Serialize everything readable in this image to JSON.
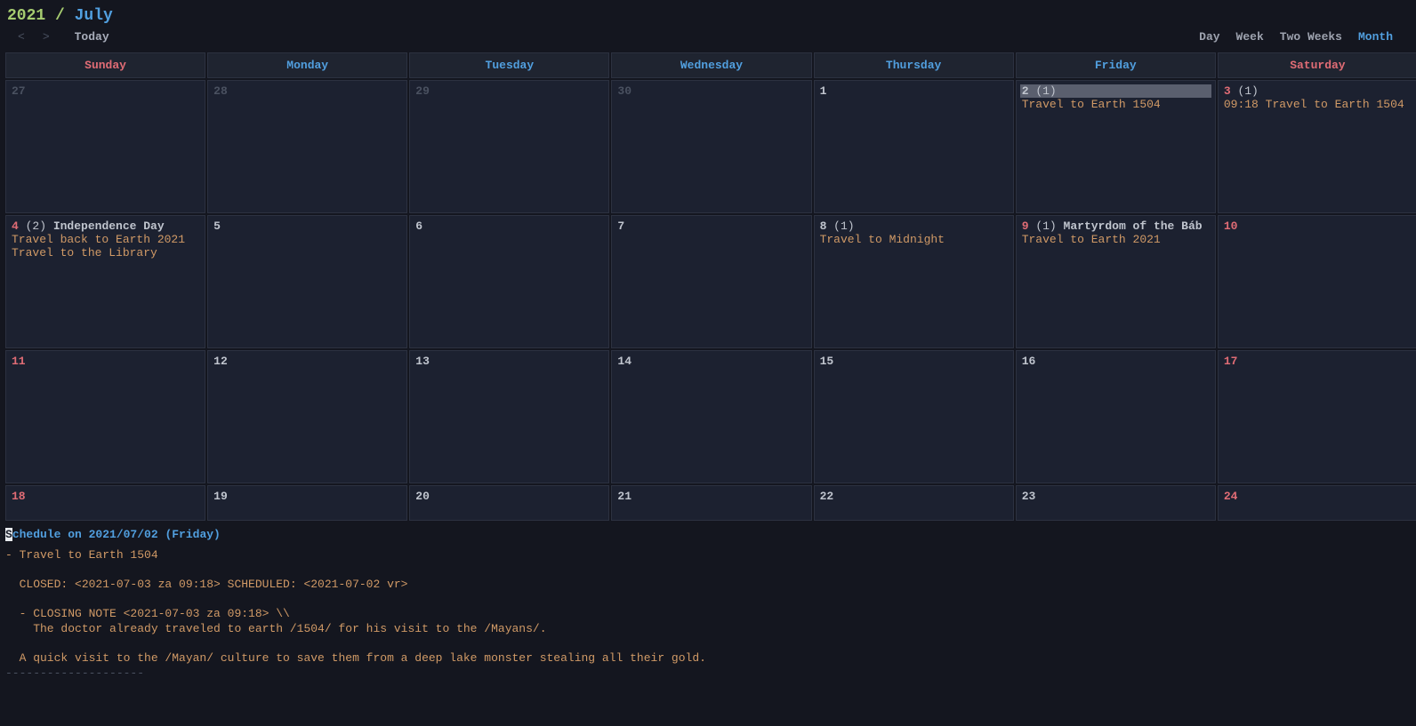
{
  "title": {
    "year": "2021",
    "sep": " / ",
    "month": "July"
  },
  "nav": {
    "prev": "<",
    "next": ">",
    "today": "Today"
  },
  "views": {
    "day": "Day",
    "week": "Week",
    "two_weeks": "Two Weeks",
    "month": "Month",
    "active": "month"
  },
  "dow": {
    "sun": "Sunday",
    "mon": "Monday",
    "tue": "Tuesday",
    "wed": "Wednesday",
    "thu": "Thursday",
    "fri": "Friday",
    "sat": "Saturday"
  },
  "cells": {
    "r0": {
      "c0": {
        "num": "27",
        "dim": true
      },
      "c1": {
        "num": "28",
        "dim": true
      },
      "c2": {
        "num": "29",
        "dim": true
      },
      "c3": {
        "num": "30",
        "dim": true
      },
      "c4": {
        "num": "1"
      },
      "c5": {
        "num": "2",
        "count": "(1)",
        "selected": true,
        "events": [
          "Travel to Earth 1504"
        ]
      },
      "c6": {
        "num": "3",
        "count": "(1)",
        "weekend": true,
        "events": [
          "09:18 Travel to Earth 1504"
        ]
      }
    },
    "r1": {
      "c0": {
        "num": "4",
        "count": "(2)",
        "weekend": true,
        "holiday": "Independence Day",
        "events": [
          "Travel back to Earth 2021",
          "Travel to the Library"
        ]
      },
      "c1": {
        "num": "5"
      },
      "c2": {
        "num": "6"
      },
      "c3": {
        "num": "7"
      },
      "c4": {
        "num": "8",
        "count": "(1)",
        "events": [
          "Travel to Midnight"
        ]
      },
      "c5": {
        "num": "9",
        "count": "(1)",
        "weekend": true,
        "holiday": "Martyrdom of the Báb",
        "events": [
          "Travel to Earth 2021"
        ]
      },
      "c6": {
        "num": "10",
        "weekend": true
      }
    },
    "r2": {
      "c0": {
        "num": "11",
        "weekend": true
      },
      "c1": {
        "num": "12"
      },
      "c2": {
        "num": "13"
      },
      "c3": {
        "num": "14"
      },
      "c4": {
        "num": "15"
      },
      "c5": {
        "num": "16"
      },
      "c6": {
        "num": "17",
        "weekend": true
      }
    },
    "r3": {
      "c0": {
        "num": "18",
        "weekend": true
      },
      "c1": {
        "num": "19"
      },
      "c2": {
        "num": "20"
      },
      "c3": {
        "num": "21"
      },
      "c4": {
        "num": "22"
      },
      "c5": {
        "num": "23"
      },
      "c6": {
        "num": "24",
        "weekend": true
      }
    }
  },
  "schedule": {
    "title_first": "S",
    "title_rest": "chedule on 2021/07/02 (Friday)",
    "lines": [
      "- Travel to Earth 1504",
      "",
      "  CLOSED: <2021-07-03 za 09:18> SCHEDULED: <2021-07-02 vr>",
      "",
      "  - CLOSING NOTE <2021-07-03 za 09:18> \\\\",
      "    The doctor already traveled to earth /1504/ for his visit to the /Mayans/.",
      "",
      "  A quick visit to the /Mayan/ culture to save them from a deep lake monster stealing all their gold.",
      ""
    ],
    "divider": "--------------------"
  }
}
